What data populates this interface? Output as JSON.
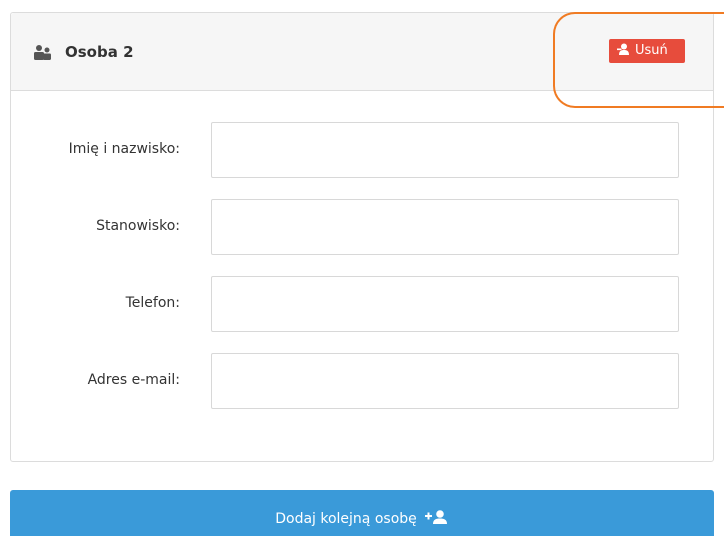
{
  "panel": {
    "title": "Osoba 2",
    "title_icon": "user-group-icon",
    "remove_button": {
      "label": "Usuń",
      "icon": "user-remove-icon",
      "color": "#e74c3c"
    }
  },
  "form": {
    "fields": [
      {
        "label": "Imię i nazwisko:",
        "value": ""
      },
      {
        "label": "Stanowisko:",
        "value": ""
      },
      {
        "label": "Telefon:",
        "value": ""
      },
      {
        "label": "Adres e-mail:",
        "value": ""
      }
    ]
  },
  "add_button": {
    "label": "Dodaj kolejną osobę",
    "icon": "user-add-icon",
    "color": "#3a9ad9"
  },
  "highlight_color": "#f07b23"
}
